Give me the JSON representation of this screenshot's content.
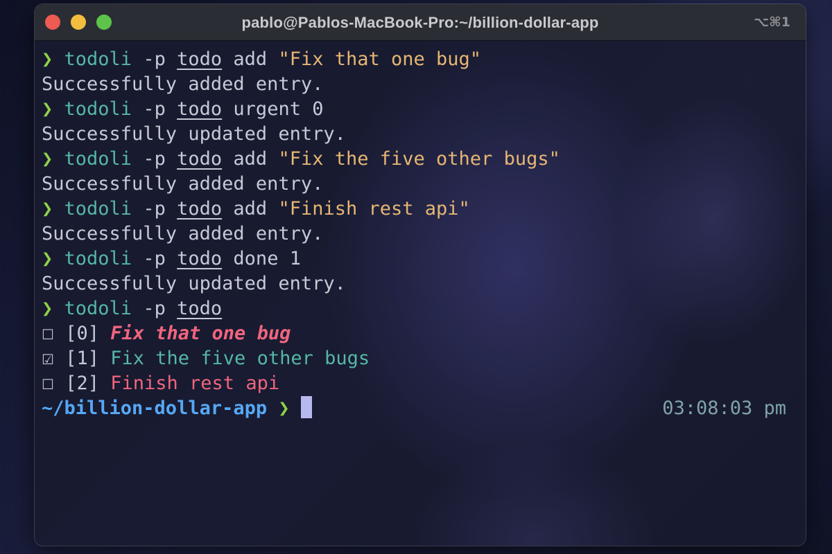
{
  "window": {
    "title": "pablo@Pablos-MacBook-Pro:~/billion-dollar-app",
    "shortcut": "⌥⌘1"
  },
  "terminal": {
    "prompt_symbol": "❯",
    "commands": [
      {
        "cmd": "todoli",
        "flag": "-p",
        "arg": "todo",
        "sub": "add",
        "rest": "\"Fix that one bug\"",
        "output": "Successfully added entry."
      },
      {
        "cmd": "todoli",
        "flag": "-p",
        "arg": "todo",
        "sub": "urgent",
        "rest": "0",
        "output": "Successfully updated entry."
      },
      {
        "cmd": "todoli",
        "flag": "-p",
        "arg": "todo",
        "sub": "add",
        "rest": "\"Fix the five other bugs\"",
        "output": "Successfully added entry."
      },
      {
        "cmd": "todoli",
        "flag": "-p",
        "arg": "todo",
        "sub": "add",
        "rest": "\"Finish rest api\"",
        "output": "Successfully added entry."
      },
      {
        "cmd": "todoli",
        "flag": "-p",
        "arg": "todo",
        "sub": "done",
        "rest": "1",
        "output": "Successfully updated entry."
      }
    ],
    "list_command": {
      "cmd": "todoli",
      "flag": "-p",
      "arg": "todo"
    },
    "todo_items": [
      {
        "checkbox": "☐",
        "index": "[0]",
        "text": "Fix that one bug",
        "status": "urgent"
      },
      {
        "checkbox": "☑",
        "index": "[1]",
        "text": "Fix the five other bugs",
        "status": "done"
      },
      {
        "checkbox": "☐",
        "index": "[2]",
        "text": "Finish rest api",
        "status": "open"
      }
    ],
    "cwd": "~/billion-dollar-app",
    "time": "03:08:03 pm"
  },
  "colors": {
    "prompt": "#8fd148",
    "command": "#55b7a6",
    "string": "#e6b673",
    "urgent": "#f0657e",
    "done": "#55b7a6",
    "cwd": "#56a8f5",
    "cursor": "#b7b8ef",
    "close": "#ed5b53",
    "minimize": "#f3be3e",
    "zoom": "#5dc34a"
  }
}
